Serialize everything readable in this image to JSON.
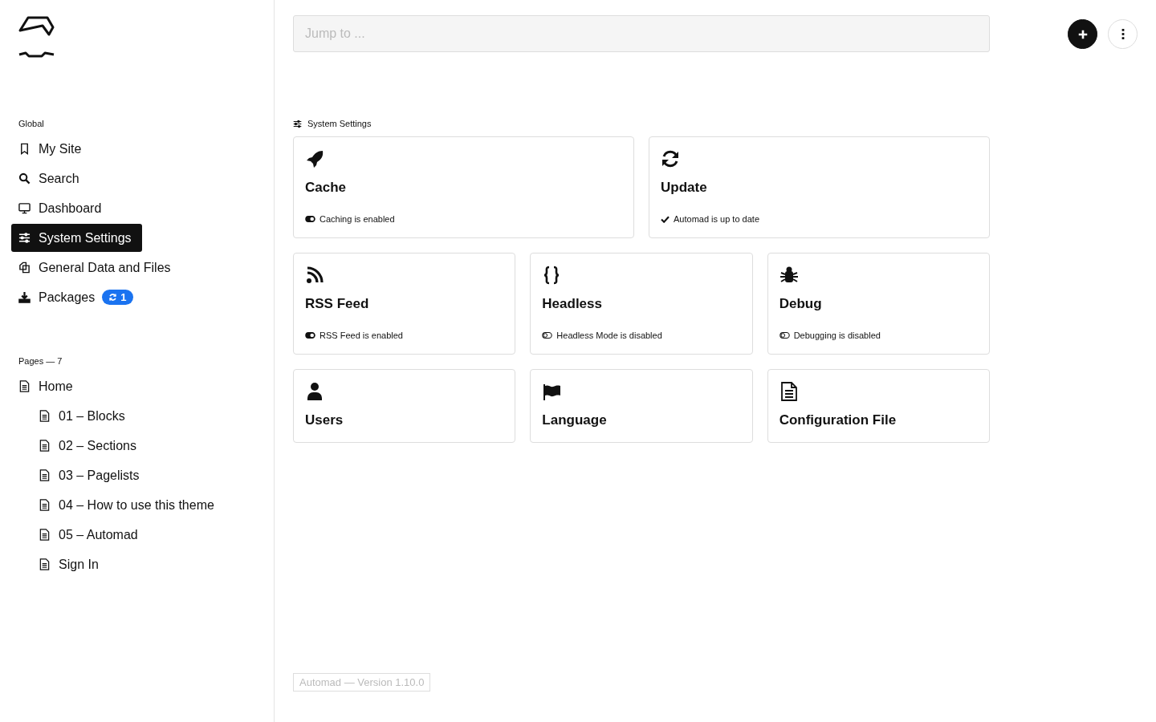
{
  "search": {
    "placeholder": "Jump to ..."
  },
  "global": {
    "label": "Global",
    "items": [
      {
        "label": "My Site",
        "selected": false
      },
      {
        "label": "Search",
        "selected": false
      },
      {
        "label": "Dashboard",
        "selected": false
      },
      {
        "label": "System Settings",
        "selected": true
      },
      {
        "label": "General Data and Files",
        "selected": false
      },
      {
        "label": "Packages",
        "selected": false,
        "badge": "1"
      }
    ]
  },
  "pages": {
    "label": "Pages — 7",
    "tree": [
      {
        "label": "Home",
        "children": [
          {
            "label": "01 – Blocks"
          },
          {
            "label": "02 – Sections"
          },
          {
            "label": "03 – Pagelists"
          },
          {
            "label": "04 – How to use this theme"
          },
          {
            "label": "05 – Automad"
          },
          {
            "label": "Sign In"
          }
        ]
      }
    ]
  },
  "section": {
    "title": "System Settings"
  },
  "cards": [
    {
      "title": "Cache",
      "status": {
        "kind": "toggle",
        "on": true,
        "text": "Caching is enabled"
      }
    },
    {
      "title": "Update",
      "status": {
        "kind": "check",
        "text": "Automad is up to date"
      }
    },
    {
      "title": "RSS Feed",
      "status": {
        "kind": "toggle",
        "on": true,
        "text": "RSS Feed is enabled"
      }
    },
    {
      "title": "Headless",
      "status": {
        "kind": "toggle",
        "on": false,
        "text": "Headless Mode is disabled"
      }
    },
    {
      "title": "Debug",
      "status": {
        "kind": "toggle",
        "on": false,
        "text": "Debugging is disabled"
      }
    },
    {
      "title": "Users"
    },
    {
      "title": "Language"
    },
    {
      "title": "Configuration File"
    }
  ],
  "footer": {
    "version": "Automad — Version 1.10.0"
  }
}
